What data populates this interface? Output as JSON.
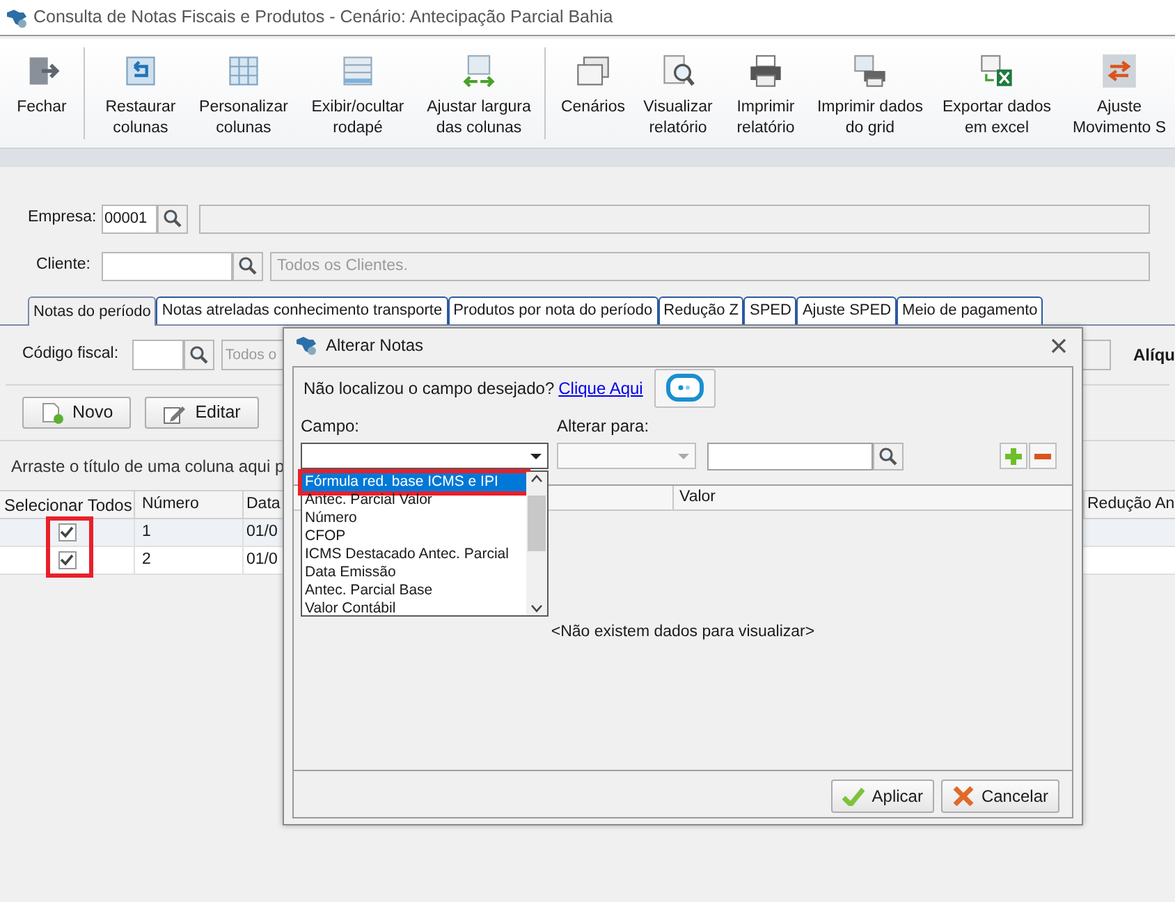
{
  "window": {
    "title": "Consulta de Notas Fiscais e Produtos - Cenário: Antecipação Parcial Bahia"
  },
  "toolbar": {
    "groups": [
      [
        {
          "label": "Fechar"
        }
      ],
      [
        {
          "label": "Restaurar colunas"
        },
        {
          "label": "Personalizar colunas"
        },
        {
          "label": "Exibir/ocultar rodapé"
        },
        {
          "label": "Ajustar largura das colunas"
        }
      ],
      [
        {
          "label": "Cenários"
        },
        {
          "label": "Visualizar relatório"
        },
        {
          "label": "Imprimir relatório"
        },
        {
          "label": "Imprimir dados do grid"
        },
        {
          "label": "Exportar dados em excel"
        },
        {
          "label": "Ajuste Movimento S"
        }
      ]
    ]
  },
  "filters": {
    "empresa": {
      "label": "Empresa:",
      "value": "00001"
    },
    "cliente": {
      "label": "Cliente:",
      "placeholder": "Todos os Clientes."
    }
  },
  "tabs": [
    {
      "label": "Notas do período",
      "selected": true
    },
    {
      "label": "Notas atreladas conhecimento transporte",
      "selected": false
    },
    {
      "label": "Produtos por nota do período",
      "selected": false
    },
    {
      "label": "Redução Z",
      "selected": false
    },
    {
      "label": "SPED",
      "selected": false
    },
    {
      "label": "Ajuste SPED",
      "selected": false
    },
    {
      "label": "Meio de pagamento",
      "selected": false
    }
  ],
  "codigo_fiscal": {
    "label": "Código fiscal:",
    "placeholder": "Todos o"
  },
  "aliquota_label": "Alíqu",
  "actions": [
    "Novo",
    "Editar"
  ],
  "group_hint": "Arraste o título de uma coluna aqui p",
  "grid": {
    "select_all": "Selecionar Todos",
    "columns": [
      "Número",
      "Data",
      "Redução An"
    ],
    "rows": [
      {
        "checked": true,
        "numero": "1",
        "data": "01/0"
      },
      {
        "checked": true,
        "numero": "2",
        "data": "01/0"
      }
    ]
  },
  "dialog": {
    "title": "Alterar Notas",
    "hint": "Não localizou o campo desejado?",
    "link": "Clique Aqui",
    "campo_label": "Campo:",
    "alterar_label": "Alterar para:",
    "dropdown": {
      "expanded": true,
      "options": [
        {
          "label": "Fórmula red. base ICMS e IPI",
          "selected": true
        },
        {
          "label": "Antec. Parcial Valor",
          "selected": false
        },
        {
          "label": "Número",
          "selected": false
        },
        {
          "label": "CFOP",
          "selected": false
        },
        {
          "label": "ICMS Destacado Antec. Parcial",
          "selected": false
        },
        {
          "label": "Data Emissão",
          "selected": false
        },
        {
          "label": "Antec. Parcial Base",
          "selected": false
        },
        {
          "label": "Valor Contábil",
          "selected": false
        }
      ]
    },
    "grid_columns": [
      "Valor"
    ],
    "empty_text": "<Não existem dados para visualizar>",
    "buttons": [
      "Aplicar",
      "Cancelar"
    ]
  }
}
